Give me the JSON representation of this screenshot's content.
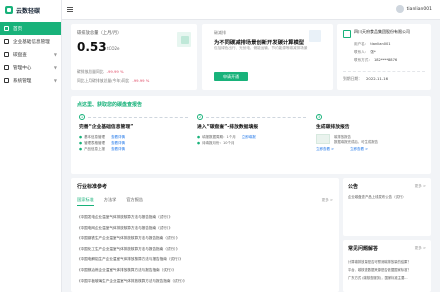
{
  "app": {
    "name": "云数轻碳"
  },
  "sidebar": {
    "items": [
      {
        "label": "首页"
      },
      {
        "label": "企业基础信息管理"
      },
      {
        "label": "碳盘查"
      },
      {
        "label": "管理中心"
      },
      {
        "label": "系统管理"
      }
    ]
  },
  "topbar": {
    "username": "tianlian001"
  },
  "emission_card": {
    "label": "碳排放总量（上月/月）",
    "value": "0.53",
    "unit": "tCO2e",
    "comparisons": [
      {
        "label": "碳排放总量同比",
        "value": "-99.99 %"
      },
      {
        "label": "同比上月碳排放总量(今年)同比",
        "value": "-99.99 %"
      }
    ]
  },
  "promo_card": {
    "tag": "碳减排",
    "title": "为不同碳减排场景创新开发碳计算模型",
    "desc": "包括绿色出行、光伏电、储能运输，节约能源等碳减排场景",
    "button": "申请开通"
  },
  "company_card": {
    "name": "四川天府食品集团股份有限公司",
    "rows": [
      {
        "label": "用户名：",
        "value": "tianlian001"
      },
      {
        "label": "联系人：",
        "value": "张*"
      },
      {
        "label": "联系方式：",
        "value": "182****8876"
      }
    ],
    "date_label": "到期日期：",
    "date": "2022-11-16"
  },
  "steps": {
    "title": "点这里、获取您的碳盘查报告",
    "items": [
      {
        "num": "1",
        "title": "完善“企业基础信息管理”",
        "lines": [
          {
            "text": "基本信息管理",
            "link": "查看详情"
          },
          {
            "text": "管理表格管理",
            "link": "查看详情"
          },
          {
            "text": "产品信息上报",
            "link": "查看详情"
          }
        ]
      },
      {
        "num": "2",
        "title": "进入“碳盘查”-排放数据填报",
        "lines": [
          {
            "text": "填报数据周期：1个月",
            "link": "立即填报"
          },
          {
            "text": "待填报月份：10个月",
            "link": ""
          }
        ]
      },
      {
        "num": "3",
        "title": "生成碳排放报告",
        "lines": [
          {
            "text": "碳排放报告",
            "link": ""
          },
          {
            "text": "数据填报完成后，可生成报告",
            "link": ""
          }
        ],
        "links": [
          "立即查看 >",
          "立即查看 >"
        ]
      }
    ]
  },
  "standards": {
    "title": "行业标准参考",
    "tabs": [
      "国家标准",
      "方法学",
      "官方报告"
    ],
    "more": "更多 >",
    "items": [
      "《中国发电企业温室气体排放核算方法与报告指南（试行）》",
      "《中国电网企业温室气体排放核算方法与报告指南（试行）》",
      "《中国钢铁生产企业温室气体排放核算方法与报告指南（试行）》",
      "《中国化工生产企业温室气体排放核算方法与报告指南（试行）》",
      "《中国电解铝生产企业温室气体排放核算方法与报告指南（试行）》",
      "《中国镁冶炼企业温室气体排放核算方法与报告指南（试行）》",
      "《中国平板玻璃生产企业温室气体排放核算方法与报告指南（试行）》"
    ]
  },
  "notice": {
    "title": "公告",
    "more": "更多 >",
    "items": [
      "企业碳盘查产品上线发布公告（试行）"
    ]
  },
  "faq": {
    "title": "常见问题解答",
    "more": "更多 >",
    "items": [
      "计算碳排放量是否可预测碳排放量的结果？",
      "平台、碳核查数据来源是否依据国家标准？",
      "广东方式 (碳核查服务)，国家标准主要..."
    ]
  }
}
